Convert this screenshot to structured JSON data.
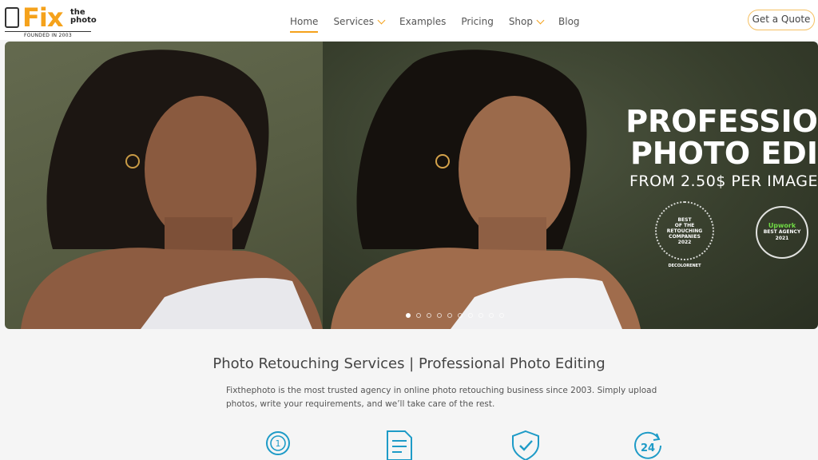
{
  "logo": {
    "brand": "Fix",
    "the": "the",
    "photo": "photo",
    "founded": "FOUNDED IN 2003"
  },
  "nav": [
    {
      "label": "Home",
      "active": true,
      "has_dropdown": false
    },
    {
      "label": "Services",
      "active": false,
      "has_dropdown": true
    },
    {
      "label": "Examples",
      "active": false,
      "has_dropdown": false
    },
    {
      "label": "Pricing",
      "active": false,
      "has_dropdown": false
    },
    {
      "label": "Shop",
      "active": false,
      "has_dropdown": true
    },
    {
      "label": "Blog",
      "active": false,
      "has_dropdown": false
    }
  ],
  "quote_button": "Get a Quote",
  "hero": {
    "line1": "PROFESSIO",
    "line2": "PHOTO EDI",
    "line3": "FROM 2.50$ PER IMAGE",
    "badge1": {
      "l1": "BEST",
      "l2": "OF THE",
      "l3": "RETOUCHING",
      "l4": "COMPANIES",
      "year": "2022",
      "source": "DECOLORENET"
    },
    "badge2": {
      "brand": "Upwork",
      "l1": "BEST AGENCY",
      "year": "2021"
    },
    "slide_count": 10,
    "active_slide": 1
  },
  "section": {
    "title": "Photo Retouching Services | Professional Photo Editing",
    "intro": "Fixthephoto is the most trusted agency in online photo retouching business since 2003. Simply upload photos, write your requirements, and we’ll take care of the rest."
  },
  "features": [
    {
      "icon": "award-medal-icon",
      "label": "1"
    },
    {
      "icon": "document-checklist-icon"
    },
    {
      "icon": "shield-check-icon"
    },
    {
      "icon": "24-hours-clock-icon",
      "label": "24"
    }
  ],
  "colors": {
    "accent": "#f5a21b",
    "icon": "#1e9bc7",
    "hero_bg": "#4e5640"
  }
}
